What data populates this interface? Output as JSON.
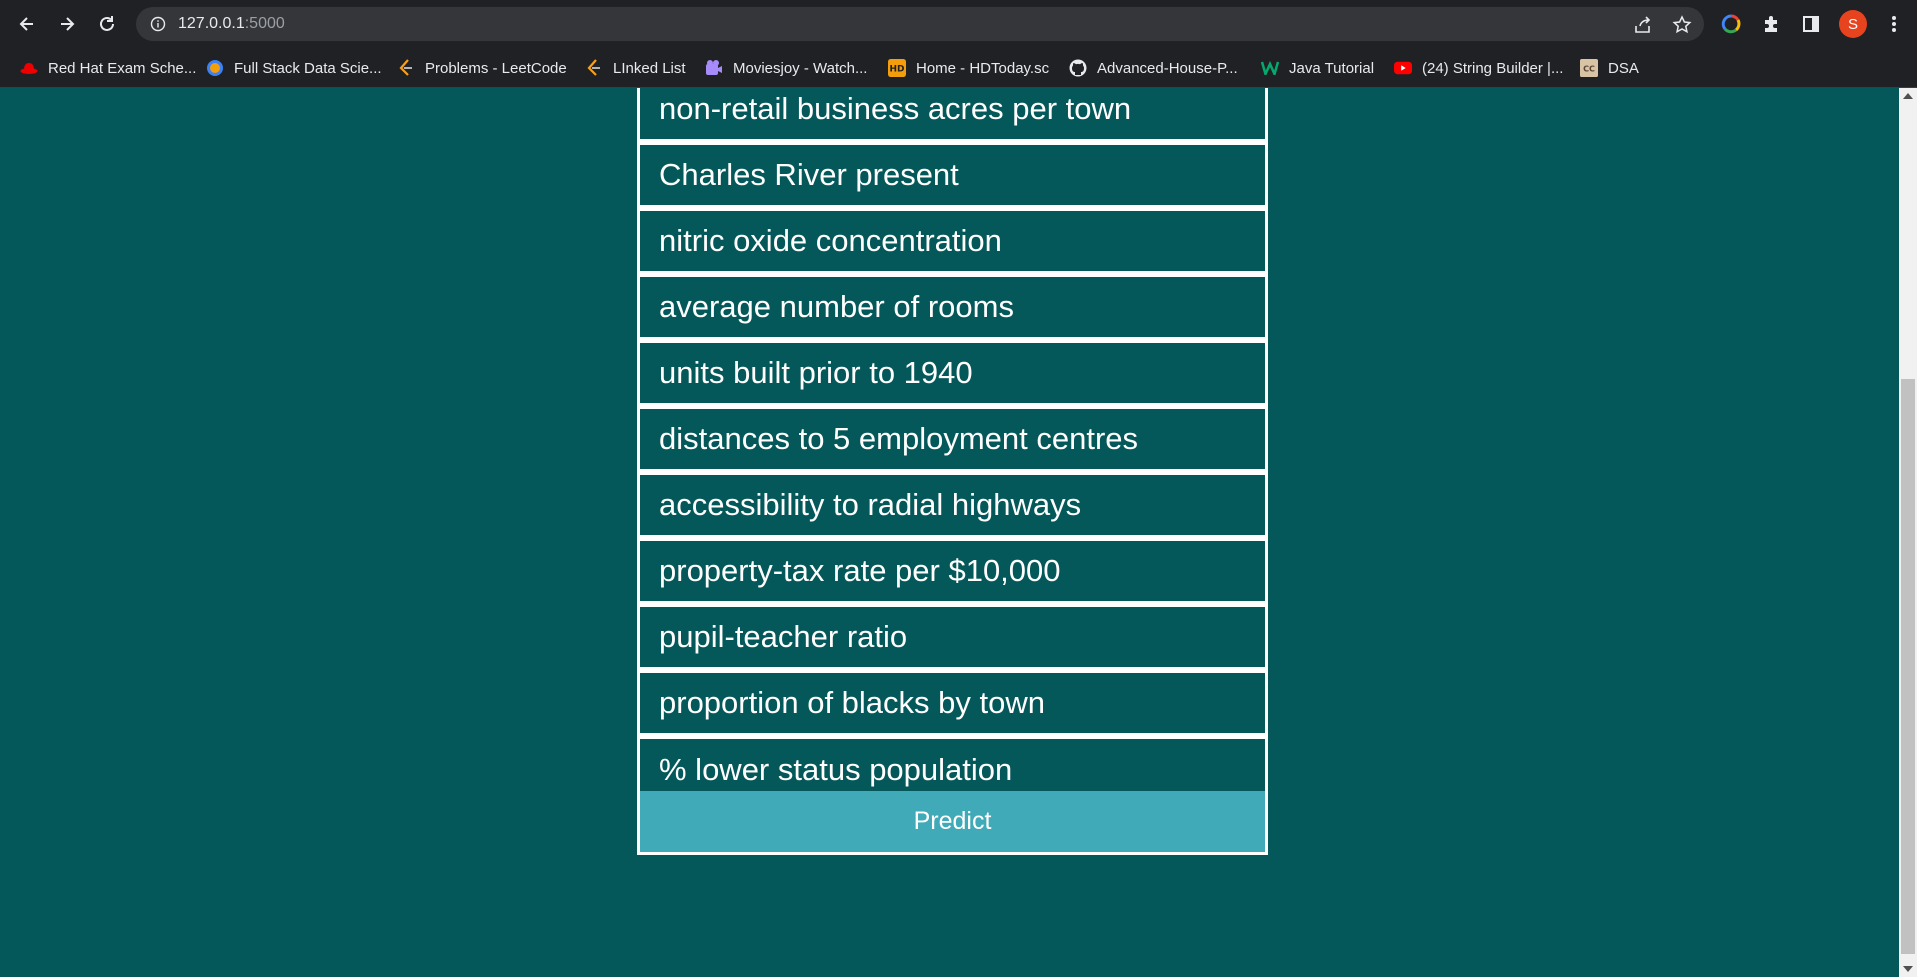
{
  "browser": {
    "url_host": "127.0.0.1",
    "url_port": ":5000",
    "profile_initial": "S",
    "accent_color": "#e8431f"
  },
  "bookmarks": [
    {
      "label": "Red Hat Exam Sche...",
      "icon": "redhat-icon"
    },
    {
      "label": "Full Stack Data Scie...",
      "icon": "ineuron-icon"
    },
    {
      "label": "Problems - LeetCode",
      "icon": "leetcode-icon"
    },
    {
      "label": "LInked List",
      "icon": "leetcode-icon"
    },
    {
      "label": "Moviesjoy - Watch...",
      "icon": "moviesjoy-icon"
    },
    {
      "label": "Home - HDToday.sc",
      "icon": "hd-icon"
    },
    {
      "label": "Advanced-House-P...",
      "icon": "github-icon"
    },
    {
      "label": "Java Tutorial",
      "icon": "w3schools-icon"
    },
    {
      "label": "(24) String Builder |...",
      "icon": "youtube-icon"
    },
    {
      "label": "DSA",
      "icon": "codechef-icon"
    }
  ],
  "form": {
    "fields": [
      {
        "placeholder": "non-retail business acres per town"
      },
      {
        "placeholder": "Charles River present"
      },
      {
        "placeholder": "nitric oxide concentration"
      },
      {
        "placeholder": "average number of rooms"
      },
      {
        "placeholder": "units built prior to 1940"
      },
      {
        "placeholder": "distances to 5 employment centres"
      },
      {
        "placeholder": "accessibility to radial highways"
      },
      {
        "placeholder": "property-tax rate per $10,000"
      },
      {
        "placeholder": "pupil-teacher ratio"
      },
      {
        "placeholder": "proportion of blacks by town"
      },
      {
        "placeholder": "% lower status population"
      }
    ],
    "submit_label": "Predict"
  },
  "colors": {
    "page_background": "#05585a",
    "button_background": "#41aab8",
    "field_border": "#ffffff"
  }
}
